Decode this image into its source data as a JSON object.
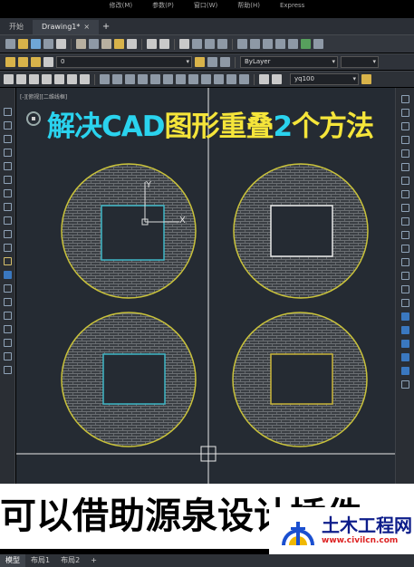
{
  "menu": [
    "修改(M)",
    "参数(P)",
    "窗口(W)",
    "帮助(H)",
    "Express"
  ],
  "doc_tabs": [
    {
      "label": "开始",
      "active": false,
      "closable": false
    },
    {
      "label": "Drawing1*",
      "active": true,
      "closable": true
    }
  ],
  "doc_tab_close": "×",
  "doc_tab_add": "+",
  "layer_dropdown": "0",
  "linetype_dropdown": "ByLayer",
  "style_dropdown": "yq100",
  "viewport_label": "[-][俯视][二维线框]",
  "video_title": {
    "part1": "解决CAD",
    "part2": "图形重叠",
    "part3": "2",
    "part4": "个方法"
  },
  "caption": "可以借助源泉设计插件",
  "ucs": {
    "y_label": "Y",
    "x_label": "X"
  },
  "watermark": {
    "name": "土木工程网",
    "url": "www.civilcn.com"
  },
  "layout_tabs": [
    "模型",
    "布局1",
    "布局2"
  ],
  "layout_add": "+",
  "colors": {
    "circle": "#c9c23a",
    "square_cyan": "#3fb7c8",
    "square_white": "#e8e8e8",
    "square_yellow": "#c9b53a",
    "title_cyan": "#2ad3ee",
    "title_yellow": "#f5e53a"
  }
}
